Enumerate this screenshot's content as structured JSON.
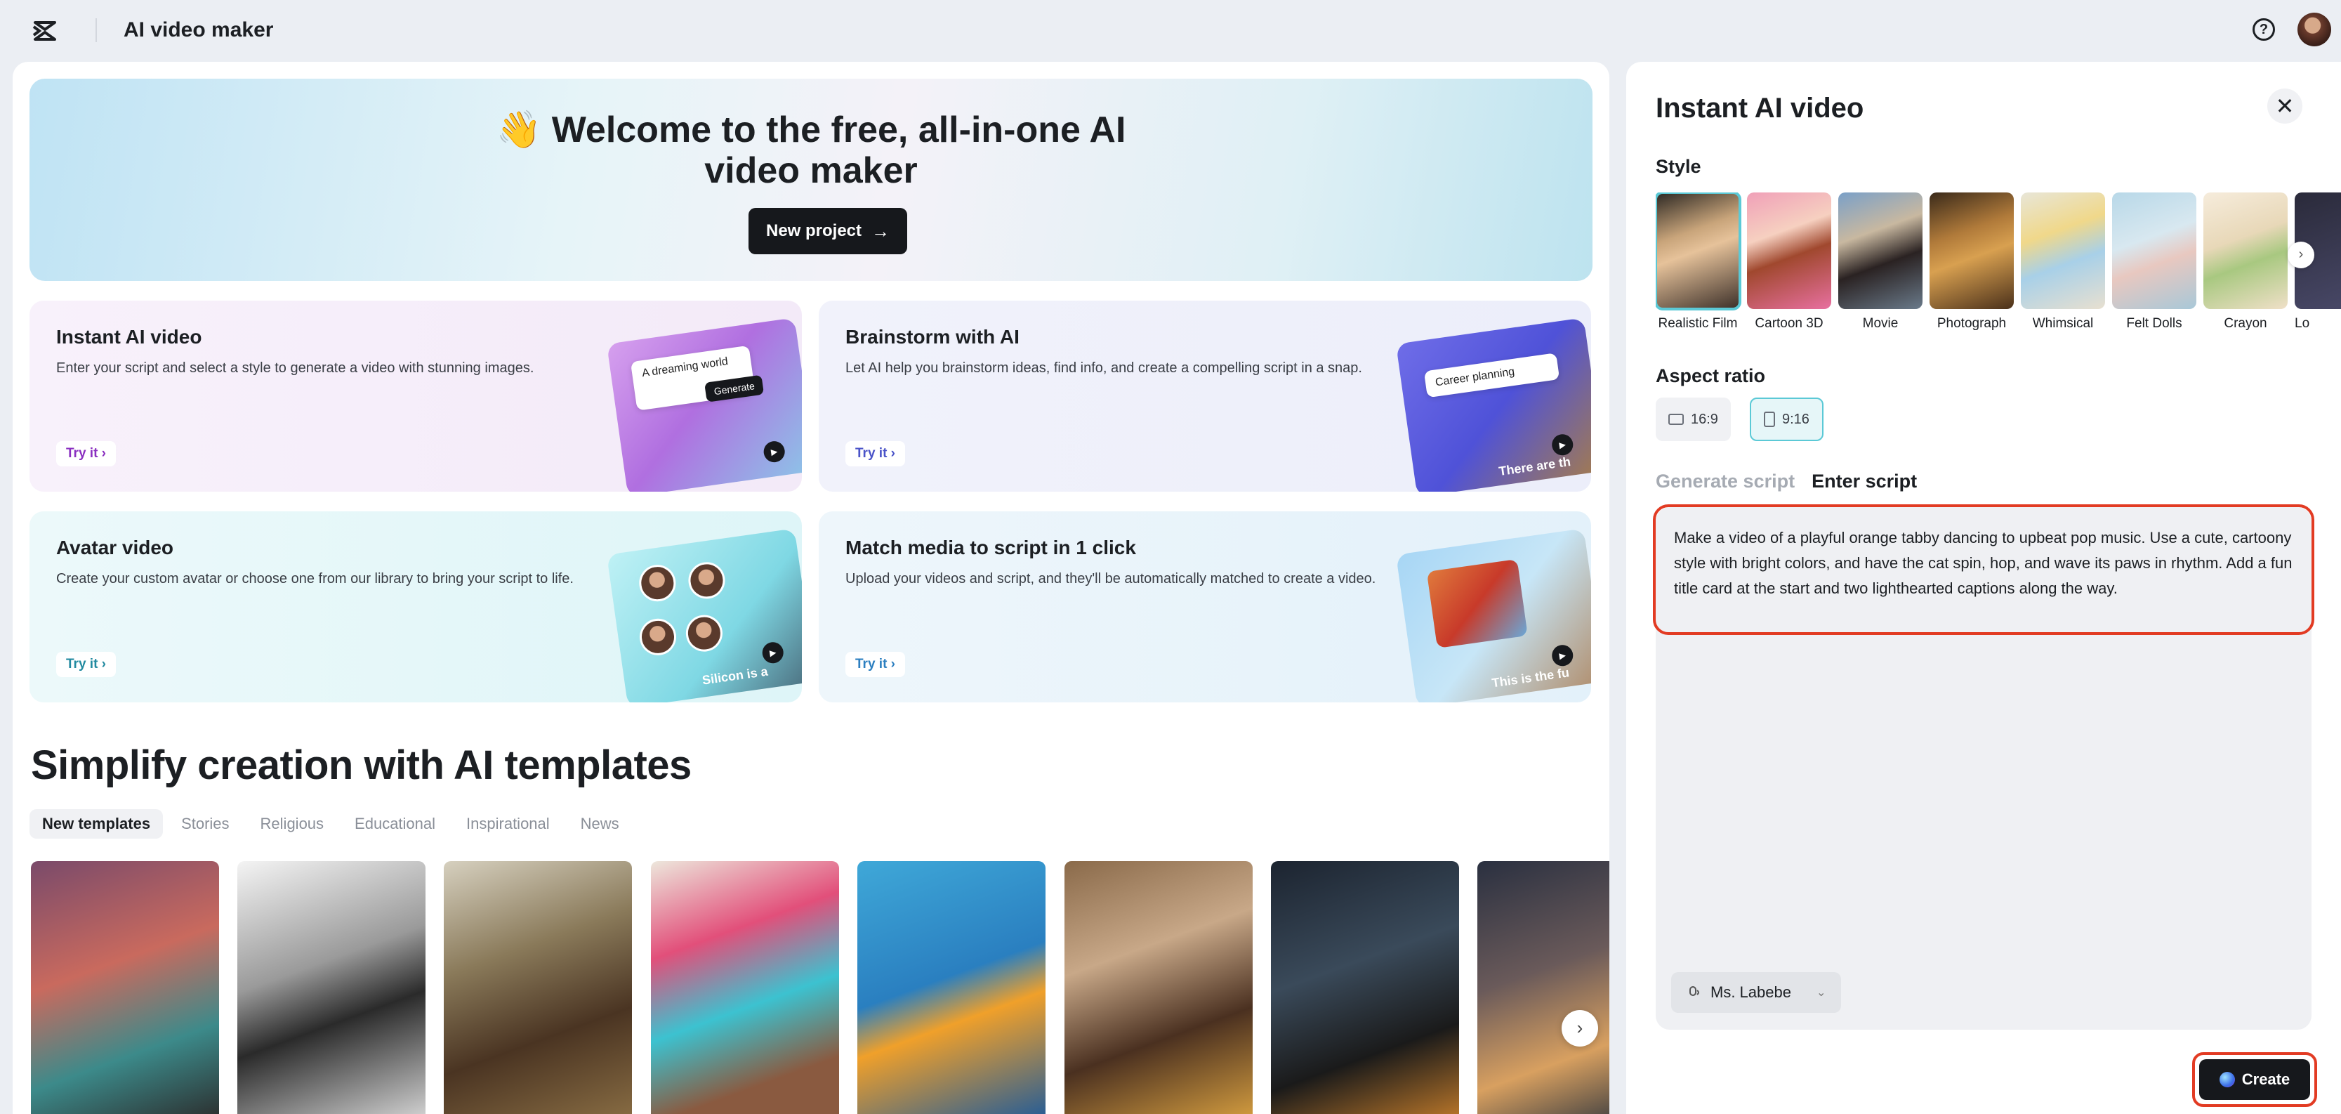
{
  "topbar": {
    "app_title": "AI video maker",
    "help_label": "?"
  },
  "hero": {
    "title_line1": "👋 Welcome to the free, all-in-one AI",
    "title_line2": "video maker",
    "new_project_label": "New project",
    "new_project_arrow": "→"
  },
  "cards": {
    "instant": {
      "title": "Instant AI video",
      "desc": "Enter your script and select a style to generate a video with stunning images.",
      "try": "Try it ›",
      "art_chip": "A dreaming world",
      "art_button": "Generate"
    },
    "brainstorm": {
      "title": "Brainstorm with AI",
      "desc": "Let AI help you brainstorm ideas, find info, and create a compelling script in a snap.",
      "try": "Try it ›",
      "art_chip": "Career planning",
      "art_caption": "There are th"
    },
    "avatar": {
      "title": "Avatar video",
      "desc": "Create your custom avatar or choose one from our library to bring your script to life.",
      "try": "Try it ›",
      "art_caption": "Silicon is a"
    },
    "match": {
      "title": "Match media to script in 1 click",
      "desc": "Upload your videos and script, and they'll be automatically matched to create a video.",
      "try": "Try it ›",
      "art_caption": "This is the fu"
    }
  },
  "templates": {
    "title": "Simplify creation with AI templates",
    "tabs": [
      "New templates",
      "Stories",
      "Religious",
      "Educational",
      "Inspirational",
      "News"
    ],
    "active_tab": "New templates"
  },
  "right_panel": {
    "title": "Instant AI video",
    "close_label": "✕",
    "style_label": "Style",
    "styles": [
      "Realistic Film",
      "Cartoon 3D",
      "Movie",
      "Photograph",
      "Whimsical",
      "Felt Dolls",
      "Crayon",
      "Lo"
    ],
    "selected_style": "Realistic Film",
    "aspect_label": "Aspect ratio",
    "aspect_options": [
      "16:9",
      "9:16"
    ],
    "selected_aspect": "9:16",
    "script_tabs": [
      "Generate script",
      "Enter script"
    ],
    "active_script_tab": "Enter script",
    "script_text": "Make a video of a playful orange tabby dancing to upbeat pop music. Use a cute, cartoony style with bright colors, and have the cat spin, hop, and wave its paws in rhythm. Add a fun title card at the start and two lighthearted captions along the way.",
    "voice": "Ms. Labebe",
    "create_label": "Create"
  },
  "colors": {
    "accent_teal": "#5bc9d6",
    "highlight_red": "#e23b23",
    "button_dark": "#16181c"
  }
}
